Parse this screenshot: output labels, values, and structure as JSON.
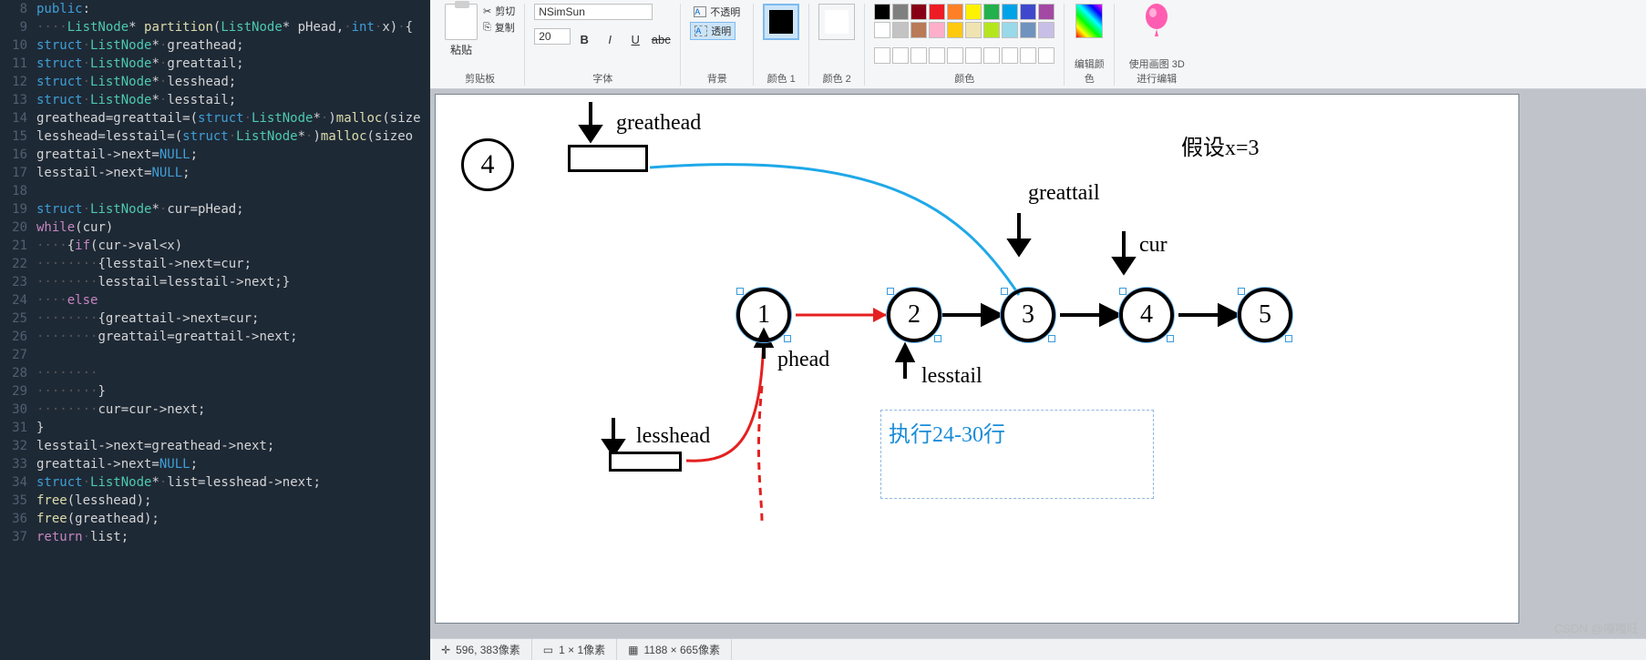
{
  "editor": {
    "lines": [
      {
        "n": 8,
        "html": "<span class='kw-blue'>public</span><span class='kw-white'>:</span>"
      },
      {
        "n": 9,
        "html": "<span class='dot'>····</span><span class='kw-cyan'>ListNode</span><span class='kw-white'>* </span><span class='kw-yellow'>partition</span><span class='kw-white'>(</span><span class='kw-cyan'>ListNode</span><span class='kw-white'>* pHead,</span><span class='dot'>·</span><span class='kw-blue'>int</span><span class='dot'>·</span><span class='kw-white'>x)</span><span class='dot'>·</span><span class='kw-white'>{</span>"
      },
      {
        "n": 10,
        "html": "<span class='kw-blue'>struct</span><span class='dot'>·</span><span class='kw-cyan'>ListNode</span><span class='kw-white'>*</span><span class='dot'>·</span><span class='kw-white'>greathead;</span>"
      },
      {
        "n": 11,
        "html": "<span class='kw-blue'>struct</span><span class='dot'>·</span><span class='kw-cyan'>ListNode</span><span class='kw-white'>*</span><span class='dot'>·</span><span class='kw-white'>greattail;</span>"
      },
      {
        "n": 12,
        "html": "<span class='kw-blue'>struct</span><span class='dot'>·</span><span class='kw-cyan'>ListNode</span><span class='kw-white'>*</span><span class='dot'>·</span><span class='kw-white'>lesshead;</span>"
      },
      {
        "n": 13,
        "html": "<span class='kw-blue'>struct</span><span class='dot'>·</span><span class='kw-cyan'>ListNode</span><span class='kw-white'>*</span><span class='dot'>·</span><span class='kw-white'>lesstail;</span>"
      },
      {
        "n": 14,
        "html": "<span class='kw-white'>greathead=greattail=(</span><span class='kw-blue'>struct</span><span class='dot'>·</span><span class='kw-cyan'>ListNode</span><span class='kw-white'>*</span><span class='dot'>·</span><span class='kw-white'>)</span><span class='kw-yellow'>malloc</span><span class='kw-white'>(size</span>"
      },
      {
        "n": 15,
        "html": "<span class='kw-white'>lesshead=lesstail=(</span><span class='kw-blue'>struct</span><span class='dot'>·</span><span class='kw-cyan'>ListNode</span><span class='kw-white'>*</span><span class='dot'>·</span><span class='kw-white'>)</span><span class='kw-yellow'>malloc</span><span class='kw-white'>(sizeo</span>"
      },
      {
        "n": 16,
        "html": "<span class='kw-white'>greattail-&gt;next=</span><span class='kw-blue'>NULL</span><span class='kw-white'>;</span>"
      },
      {
        "n": 17,
        "html": "<span class='kw-white'>lesstail-&gt;next=</span><span class='kw-blue'>NULL</span><span class='kw-white'>;</span>"
      },
      {
        "n": 18,
        "html": ""
      },
      {
        "n": 19,
        "html": "<span class='kw-blue'>struct</span><span class='dot'>·</span><span class='kw-cyan'>ListNode</span><span class='kw-white'>*</span><span class='dot'>·</span><span class='kw-white'>cur=pHead;</span>"
      },
      {
        "n": 20,
        "html": "<span class='kw-purple'>while</span><span class='kw-white'>(cur)</span>"
      },
      {
        "n": 21,
        "html": "<span class='dot'>····</span><span class='kw-white'>{</span><span class='kw-purple'>if</span><span class='kw-white'>(cur-&gt;val&lt;x)</span>"
      },
      {
        "n": 22,
        "html": "<span class='dot'>········</span><span class='kw-white'>{lesstail-&gt;next=cur;</span>"
      },
      {
        "n": 23,
        "html": "<span class='dot'>········</span><span class='kw-white'>lesstail=lesstail-&gt;next;}</span>"
      },
      {
        "n": 24,
        "html": "<span class='dot'>····</span><span class='kw-purple'>else</span>"
      },
      {
        "n": 25,
        "html": "<span class='dot'>········</span><span class='kw-white'>{greattail-&gt;next=cur;</span>"
      },
      {
        "n": 26,
        "html": "<span class='dot'>········</span><span class='kw-white'>greattail=greattail-&gt;next;</span>"
      },
      {
        "n": 27,
        "html": ""
      },
      {
        "n": 28,
        "html": "<span class='dot'>········</span>"
      },
      {
        "n": 29,
        "html": "<span class='dot'>········</span><span class='kw-white'>}</span>"
      },
      {
        "n": 30,
        "html": "<span class='dot'>········</span><span class='kw-white'>cur=cur-&gt;next;</span>"
      },
      {
        "n": 31,
        "html": "<span class='kw-white'>}</span>"
      },
      {
        "n": 32,
        "html": "<span class='kw-white'>lesstail-&gt;next=greathead-&gt;next;</span>"
      },
      {
        "n": 33,
        "html": "<span class='kw-white'>greattail-&gt;next=</span><span class='kw-blue'>NULL</span><span class='kw-white'>;</span>"
      },
      {
        "n": 34,
        "html": "<span class='kw-blue'>struct</span><span class='dot'>·</span><span class='kw-cyan'>ListNode</span><span class='kw-white'>*</span><span class='dot'>·</span><span class='kw-white'>list=lesshead-&gt;next;</span>"
      },
      {
        "n": 35,
        "html": "<span class='kw-yellow'>free</span><span class='kw-white'>(lesshead);</span>"
      },
      {
        "n": 36,
        "html": "<span class='kw-yellow'>free</span><span class='kw-white'>(greathead);</span>"
      },
      {
        "n": 37,
        "html": "<span class='kw-purple'>return</span><span class='dot'>·</span><span class='kw-white'>list;</span>"
      }
    ]
  },
  "ribbon": {
    "paste": "粘贴",
    "cut": "剪切",
    "copy": "复制",
    "clipboard": "剪贴板",
    "font_name": "NSimSun",
    "font_size": "20",
    "font": "字体",
    "opaque": "不透明",
    "transparent": "透明",
    "background": "背景",
    "color1": "颜色 1",
    "color2": "颜色 2",
    "colors": "颜色",
    "edit_color": "编辑颜色",
    "paint3d": "使用画图 3D 进行编辑",
    "palette": [
      "#000000",
      "#7f7f7f",
      "#880015",
      "#ed1c24",
      "#ff7f27",
      "#fff200",
      "#22b14c",
      "#00a2e8",
      "#3f48cc",
      "#a349a4",
      "#ffffff",
      "#c3c3c3",
      "#b97a57",
      "#ffaec9",
      "#ffc90e",
      "#efe4b0",
      "#b5e61d",
      "#99d9ea",
      "#7092be",
      "#c8bfe7"
    ]
  },
  "status": {
    "pos": "596, 383像素",
    "sel": "1 × 1像素",
    "size": "1188 × 665像素"
  },
  "diagram": {
    "greathead": "greathead",
    "greattail": "greattail",
    "cur": "cur",
    "phead": "phead",
    "lesstail": "lesstail",
    "lesshead": "lesshead",
    "assume": "假设x=3",
    "exec": "执行24-30行",
    "step": "4",
    "nodes": [
      "1",
      "2",
      "3",
      "4",
      "5"
    ]
  },
  "watermark": "CSDN @嘎嘎旺"
}
